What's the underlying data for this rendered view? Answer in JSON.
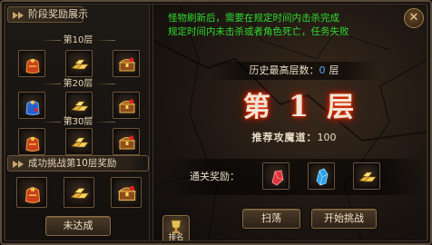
{
  "left_panel": {
    "title": "阶段奖励展示",
    "tiers": [
      {
        "label": "第10层",
        "items": [
          "gift-bag-icon",
          "gold-bars-icon",
          "treasure-chest-icon"
        ]
      },
      {
        "label": "第20层",
        "items": [
          "blue-gift-bag-icon",
          "gold-bars-icon",
          "treasure-chest-icon"
        ]
      },
      {
        "label": "第30层",
        "items": [
          "gift-bag-icon",
          "gold-bars-icon",
          "treasure-chest-icon"
        ]
      }
    ],
    "success_title": "成功挑战第10层奖励",
    "success_items": [
      "gift-bag-icon",
      "gold-bars-icon",
      "treasure-chest-icon"
    ],
    "status_button": "未达成"
  },
  "right_panel": {
    "notice_line1": "怪物刷新后，需要在规定时间内击杀完成",
    "notice_line2": "规定时间内未击杀或者角色死亡，任务失败",
    "history_label": "历史最高层数：",
    "history_value": "0",
    "history_unit": "层",
    "floor_prefix": "第",
    "floor_number": "1",
    "floor_suffix": "层",
    "route_label": "推荐攻魔道：",
    "route_value": "100",
    "reward_label": "通关奖励：",
    "reward_items": [
      "red-gem-icon",
      "blue-crystal-icon",
      "gold-bars-icon"
    ],
    "sweep_button": "扫荡",
    "start_button": "开始挑战",
    "rank_button": "排名",
    "close_symbol": "✕"
  },
  "colors": {
    "notice_green": "#2fdc2f",
    "history_value_blue": "#5aa7ff",
    "floor_glow": "#d42000",
    "border_gold": "#8a6c44"
  }
}
